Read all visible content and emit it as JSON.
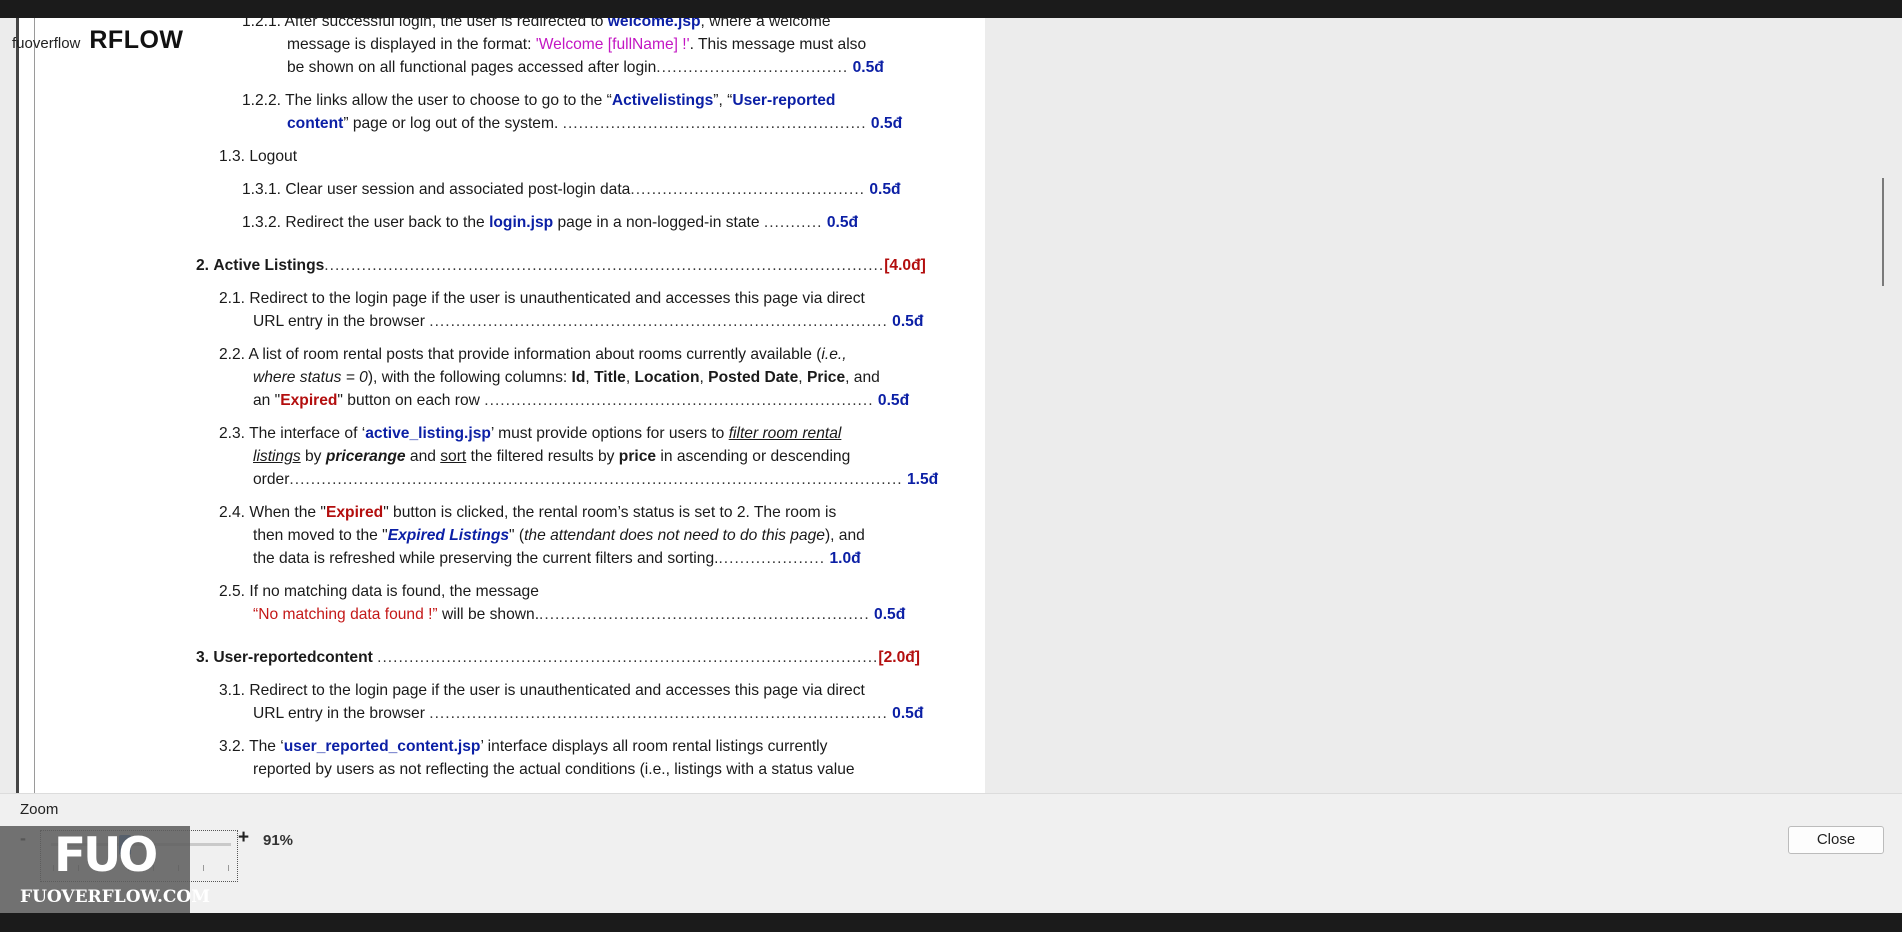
{
  "brand": {
    "small": "fuoverflow",
    "big": "RFLOW"
  },
  "doc": {
    "l1": {
      "num": "1.2.1.",
      "a": "After successful login, the user is redirected to ",
      "b": "welcome.jsp",
      "c": ", where a welcome"
    },
    "l2": {
      "a": "message is displayed in the format: ",
      "b": "'Welcome [fullName] !'",
      "c": ". This message must also"
    },
    "l3": {
      "a": "be shown on all functional pages accessed after login",
      "dots": "....................................",
      "score": "0.5đ"
    },
    "l4": {
      "num": "1.2.2.",
      "a": "The links allow the user to choose to go to the “",
      "b": "Activelistings",
      "c": "”, “",
      "d": "User-reported"
    },
    "l5": {
      "a": "content",
      "b": "” page or log out of the system.",
      "dots": ".........................................................",
      "score": "0.5đ"
    },
    "l6": {
      "text": "1.3. Logout"
    },
    "l7": {
      "num": "1.3.1.",
      "a": "Clear user session and associated post-login data",
      "dots": "............................................",
      "score": "0.5đ"
    },
    "l8": {
      "num": "1.3.2.",
      "a": "Redirect the user back to the ",
      "b": "login.jsp",
      "c": " page in a non-logged-in state",
      "dots": "...........",
      "score": "0.5đ"
    },
    "l9": {
      "num": "2.",
      "a": "Active Listings",
      "dots": ".........................................................................................................",
      "score": "[4.0đ]"
    },
    "l10": {
      "num": "2.1.",
      "a": "Redirect to the login page if the user is unauthenticated and accesses this page via direct"
    },
    "l11": {
      "a": "URL entry in the browser",
      "dots": "......................................................................................",
      "score": "0.5đ"
    },
    "l12": {
      "num": "2.2.",
      "a": "A list of room rental posts that provide information about rooms currently available (",
      "b": "i.e.,"
    },
    "l13": {
      "a": "where status = 0",
      "b": "), with the following columns: ",
      "c": "Id",
      "d": ", ",
      "e": "Title",
      "f": ", ",
      "g": "Location",
      "h": ", ",
      "i": "Posted Date",
      "j": ", ",
      "k": "Price",
      "l": ", and"
    },
    "l14": {
      "a": "an \"",
      "b": "Expired",
      "c": "\" button on each row",
      "dots": ".........................................................................",
      "score": "0.5đ"
    },
    "l15": {
      "num": "2.3.",
      "a": "The interface of ‘",
      "b": "active_listing.jsp",
      "c": "’ must provide options for users to ",
      "d": "filter room rental"
    },
    "l16": {
      "a": "listings",
      "b": " by ",
      "c": "pricerange",
      "d": " and ",
      "e": "sort",
      "f": " the filtered results by ",
      "g": "price",
      "h": " in ascending or descending"
    },
    "l17": {
      "a": "order",
      "dots": "...................................................................................................................",
      "score": "1.5đ"
    },
    "l18": {
      "num": "2.4.",
      "a": "When the \"",
      "b": "Expired",
      "c": "\" button is clicked, the rental room’s status is set to 2. The room is"
    },
    "l19": {
      "a": "then moved to the \"",
      "b": "Expired Listings",
      "c": "\" (",
      "d": "the attendant does not need to do this page",
      "e": "), and"
    },
    "l20": {
      "a": "the data is refreshed while preserving the current filters and sorting.",
      "dots": "....................",
      "score": "1.0đ"
    },
    "l21": {
      "num": "2.5.",
      "a": "If no matching data is found, the message"
    },
    "l22": {
      "a": "“No matching data found !”",
      "b": " will be shown.",
      "dots": "..............................................................",
      "score": "0.5đ"
    },
    "l23": {
      "num": "3.",
      "a": "User-reportedcontent",
      "dots": "..............................................................................................",
      "score": "[2.0đ]"
    },
    "l24": {
      "num": "3.1.",
      "a": "Redirect to the login page if the user is unauthenticated and accesses this page via direct"
    },
    "l25": {
      "a": "URL entry in the browser",
      "dots": "......................................................................................",
      "score": "0.5đ"
    },
    "l26": {
      "num": "3.2.",
      "a": "The ‘",
      "b": "user_reported_content.jsp",
      "c": "’ interface displays all room rental listings currently"
    },
    "l27": {
      "a": "reported by users as not reflecting the actual conditions (i.e., listings with a status value"
    }
  },
  "zoom": {
    "label": "Zoom",
    "minus": "-",
    "plus": "+",
    "value": "91%",
    "level_percent": 91
  },
  "logo": {
    "mark": "FUO",
    "text": "FUOVERFLOW.COM"
  },
  "close_label": "Close",
  "colors": {
    "blue": "#0b1fa5",
    "magenta": "#c316c3",
    "red": "#b30e0e",
    "thumb": "#1e63c4"
  }
}
